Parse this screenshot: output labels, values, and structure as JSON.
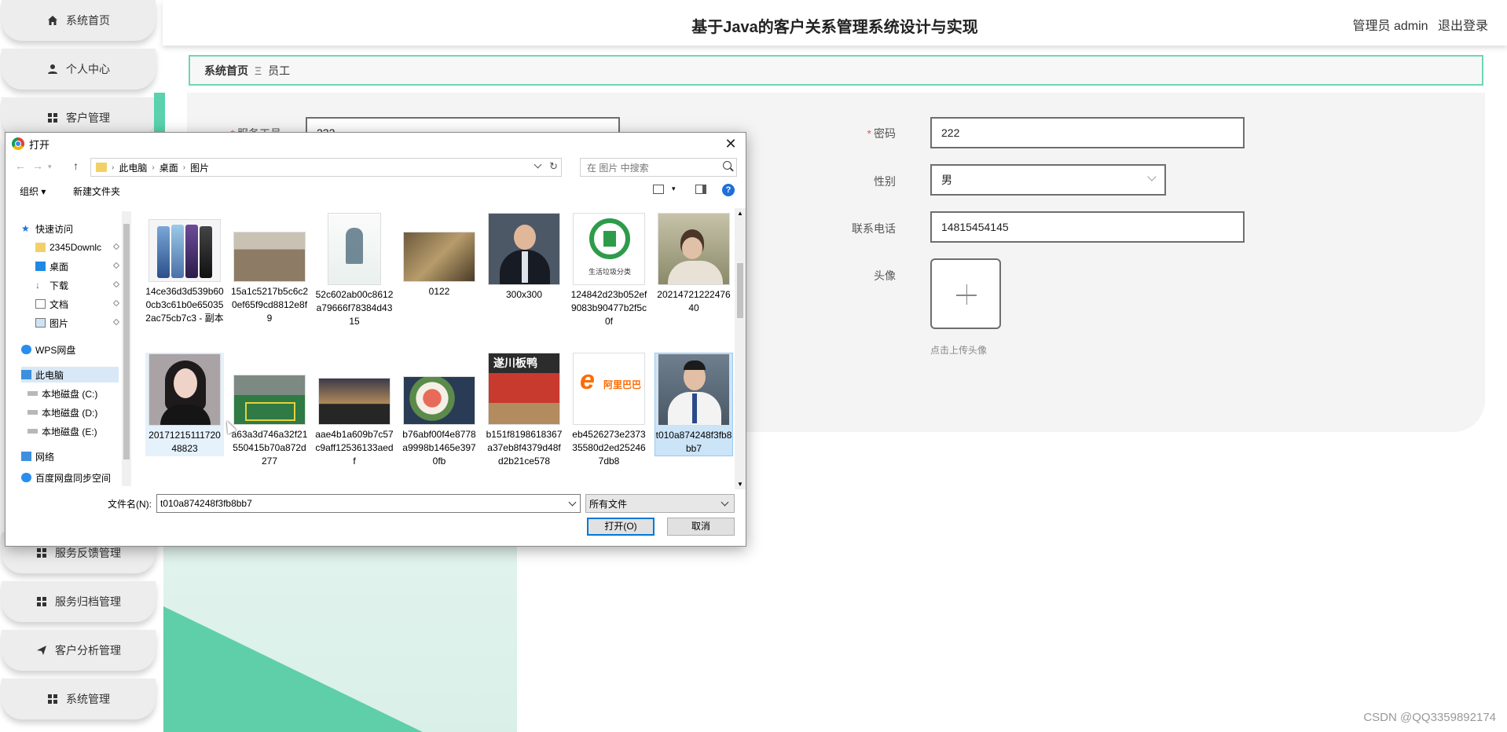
{
  "app": {
    "title": "基于Java的客户关系管理系统设计与实现",
    "user_label": "管理员 admin",
    "logout_label": "退出登录",
    "watermark": "CSDN @QQ3359892174",
    "accent_color": "#5fcfa9"
  },
  "sidebar": {
    "items": [
      {
        "label": "系统首页",
        "icon": "home-icon"
      },
      {
        "label": "个人中心",
        "icon": "person-icon"
      },
      {
        "label": "客户管理",
        "icon": "grid-icon"
      },
      {
        "label": "服务反馈管理",
        "icon": "grid-icon"
      },
      {
        "label": "服务归档管理",
        "icon": "grid-icon"
      },
      {
        "label": "客户分析管理",
        "icon": "send-icon"
      },
      {
        "label": "系统管理",
        "icon": "grid-icon"
      }
    ]
  },
  "breadcrumb": {
    "home": "系统首页",
    "separator": "Ξ",
    "current": "员工"
  },
  "form": {
    "employee_no_label": "服务工号",
    "employee_no_value": "222",
    "password_label": "密码",
    "password_value": "222",
    "gender_label": "性别",
    "gender_value": "男",
    "phone_label": "联系电话",
    "phone_value": "14815454145",
    "avatar_label": "头像",
    "avatar_hint": "点击上传头像"
  },
  "dialog": {
    "title": "打开",
    "path": [
      "此电脑",
      "桌面",
      "图片"
    ],
    "search_placeholder": "在 图片 中搜索",
    "organize_label": "组织 ▾",
    "new_folder_label": "新建文件夹",
    "help_label": "?",
    "nav_items": [
      {
        "label": "快速访问",
        "icon": "star-icon"
      },
      {
        "label": "2345Downlc",
        "icon": "folder-icon",
        "pinned": true
      },
      {
        "label": "桌面",
        "icon": "desktop-icon",
        "pinned": true
      },
      {
        "label": "下载",
        "icon": "download-icon",
        "pinned": true
      },
      {
        "label": "文档",
        "icon": "document-icon",
        "pinned": true
      },
      {
        "label": "图片",
        "icon": "pictures-icon",
        "pinned": true
      },
      {
        "label": "WPS网盘",
        "icon": "cloud-icon"
      },
      {
        "label": "此电脑",
        "icon": "computer-icon",
        "selected": true
      },
      {
        "label": "本地磁盘 (C:)",
        "icon": "disk-icon"
      },
      {
        "label": "本地磁盘 (D:)",
        "icon": "disk-icon"
      },
      {
        "label": "本地磁盘 (E:)",
        "icon": "disk-icon"
      },
      {
        "label": "网络",
        "icon": "network-icon"
      },
      {
        "label": "百度网盘同步空间",
        "icon": "cloud-icon"
      }
    ],
    "files_row1": [
      {
        "name": "14ce36d3d539b600cb3c61b0e650352ac75cb7c3 - 副本",
        "kind": "phones"
      },
      {
        "name": "15a1c5217b5c6c20ef65f9cd8812e8f9",
        "kind": "classroom"
      },
      {
        "name": "52c602ab00c8612a79666f78384d4315",
        "kind": "book"
      },
      {
        "name": "0122",
        "kind": "food"
      },
      {
        "name": "300x300",
        "kind": "man"
      },
      {
        "name": "124842d23b052ef9083b90477b2f5c0f",
        "kind": "recycle"
      },
      {
        "name": "2021472122247640",
        "kind": "boy"
      }
    ],
    "files_row2": [
      {
        "name": "2017121511172048823",
        "kind": "woman"
      },
      {
        "name": "a63a3d746a32f21550415b70a872d277",
        "kind": "parking"
      },
      {
        "name": "aae4b1a609b7c57c9aff12536133aedf",
        "kind": "sunset"
      },
      {
        "name": "b76abf00f4e8778a9998b1465e3970fb",
        "kind": "sashimi"
      },
      {
        "name": "b151f8198618367a37eb8f4379d48fd2b21ce578",
        "kind": "poster"
      },
      {
        "name": "eb4526273e237335580d2ed252467db8",
        "kind": "alibaba"
      },
      {
        "name": "t010a874248f3fb8bb7",
        "kind": "doctor",
        "selected": true
      }
    ],
    "recycle_caption": "生活垃圾分类",
    "alibaba_caption": "阿里巴巴",
    "poster_caption": "遂川板鸭",
    "filename_label": "文件名(N):",
    "filename_value": "t010a874248f3fb8bb7",
    "filetype_value": "所有文件",
    "open_label": "打开(O)",
    "cancel_label": "取消"
  }
}
